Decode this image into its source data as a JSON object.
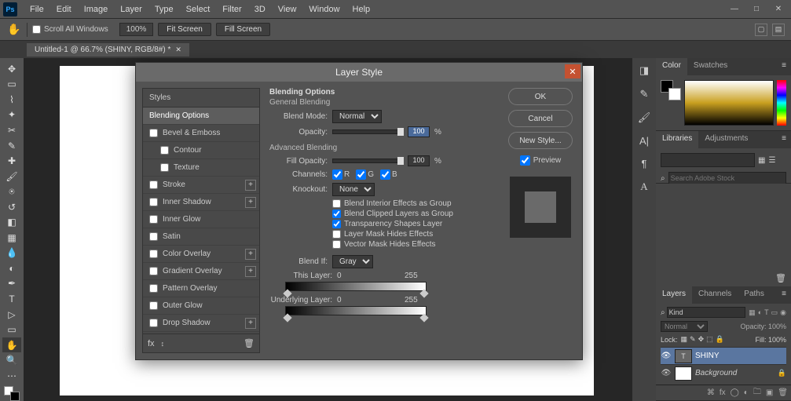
{
  "menubar": {
    "logo": "Ps",
    "items": [
      "File",
      "Edit",
      "Image",
      "Layer",
      "Type",
      "Select",
      "Filter",
      "3D",
      "View",
      "Window",
      "Help"
    ]
  },
  "optbar": {
    "scroll_label": "Scroll All Windows",
    "zoom": "100%",
    "fit": "Fit Screen",
    "fill": "Fill Screen"
  },
  "doctab": {
    "title": "Untitled-1 @ 66.7% (SHINY, RGB/8#) *"
  },
  "dialog": {
    "title": "Layer Style",
    "styles_header": "Styles",
    "styles": [
      {
        "label": "Blending Options",
        "selected": true,
        "chk": false,
        "plus": false
      },
      {
        "label": "Bevel & Emboss",
        "chk": true,
        "plus": false
      },
      {
        "label": "Contour",
        "chk": true,
        "indent": true,
        "plus": false
      },
      {
        "label": "Texture",
        "chk": true,
        "indent": true,
        "plus": false
      },
      {
        "label": "Stroke",
        "chk": true,
        "plus": true
      },
      {
        "label": "Inner Shadow",
        "chk": true,
        "plus": true
      },
      {
        "label": "Inner Glow",
        "chk": true,
        "plus": false
      },
      {
        "label": "Satin",
        "chk": true,
        "plus": false
      },
      {
        "label": "Color Overlay",
        "chk": true,
        "plus": true
      },
      {
        "label": "Gradient Overlay",
        "chk": true,
        "plus": true
      },
      {
        "label": "Pattern Overlay",
        "chk": true,
        "plus": false
      },
      {
        "label": "Outer Glow",
        "chk": true,
        "plus": false
      },
      {
        "label": "Drop Shadow",
        "chk": true,
        "plus": true
      }
    ],
    "opts": {
      "heading": "Blending Options",
      "general": "General Blending",
      "blend_mode_lbl": "Blend Mode:",
      "blend_mode": "Normal",
      "opacity_lbl": "Opacity:",
      "opacity": "100",
      "pct": "%",
      "advanced": "Advanced Blending",
      "fill_lbl": "Fill Opacity:",
      "fill": "100",
      "channels_lbl": "Channels:",
      "ch_r": "R",
      "ch_g": "G",
      "ch_b": "B",
      "knockout_lbl": "Knockout:",
      "knockout": "None",
      "c1": "Blend Interior Effects as Group",
      "c2": "Blend Clipped Layers as Group",
      "c3": "Transparency Shapes Layer",
      "c4": "Layer Mask Hides Effects",
      "c5": "Vector Mask Hides Effects",
      "blend_if_lbl": "Blend If:",
      "blend_if": "Gray",
      "this_layer": "This Layer:",
      "this_lo": "0",
      "this_hi": "255",
      "under": "Underlying Layer:",
      "under_lo": "0",
      "under_hi": "255"
    },
    "buttons": {
      "ok": "OK",
      "cancel": "Cancel",
      "newstyle": "New Style...",
      "preview": "Preview"
    }
  },
  "panels": {
    "color_tab": "Color",
    "swatches_tab": "Swatches",
    "lib_tab": "Libraries",
    "adj_tab": "Adjustments",
    "search_ph": "Search Adobe Stock",
    "layers_tab": "Layers",
    "channels_tab": "Channels",
    "paths_tab": "Paths",
    "kind": "Kind",
    "normal": "Normal",
    "opacity_lbl": "Opacity:",
    "opacity": "100%",
    "lock_lbl": "Lock:",
    "fill_lbl": "Fill:",
    "fill": "100%",
    "layer1": "SHINY",
    "layer2": "Background"
  }
}
